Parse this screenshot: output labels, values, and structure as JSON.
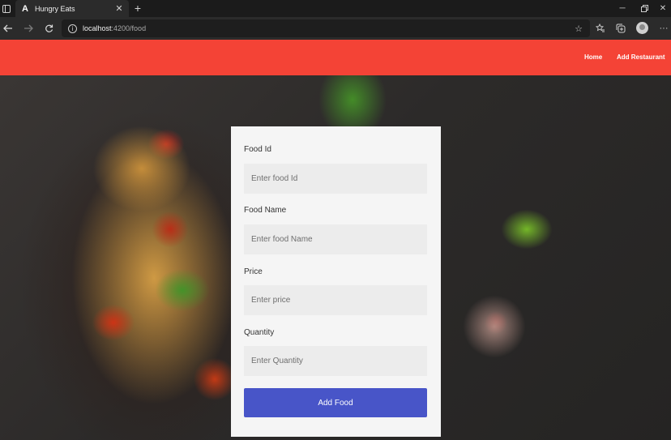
{
  "browser": {
    "tab_title": "Hungry Eats",
    "tab_favicon": "A",
    "url_host": "localhost",
    "url_path": ":4200/food",
    "icons": {
      "tab_actions": "tab-actions-icon",
      "close_tab": "close-icon",
      "new_tab": "plus-icon",
      "back": "back-arrow-icon",
      "forward": "forward-arrow-icon",
      "refresh": "refresh-icon",
      "site_info": "info-icon",
      "add_favorite": "star-plus-icon",
      "favorites": "favorites-icon",
      "collections": "collections-icon",
      "profile": "profile-avatar",
      "more": "more-icon",
      "minimize": "minimize-icon",
      "restore": "restore-icon",
      "close_window": "close-icon"
    }
  },
  "navbar": {
    "color": "#f44336",
    "links": [
      {
        "label": "Home"
      },
      {
        "label": "Add Restaurant"
      }
    ]
  },
  "form": {
    "fields": [
      {
        "label": "Food Id",
        "placeholder": "Enter food Id",
        "value": ""
      },
      {
        "label": "Food Name",
        "placeholder": "Enter food Name",
        "value": ""
      },
      {
        "label": "Price",
        "placeholder": "Enter price",
        "value": ""
      },
      {
        "label": "Quantity",
        "placeholder": "Enter Quantity",
        "value": ""
      }
    ],
    "submit_label": "Add Food",
    "submit_color": "#4855c8"
  }
}
